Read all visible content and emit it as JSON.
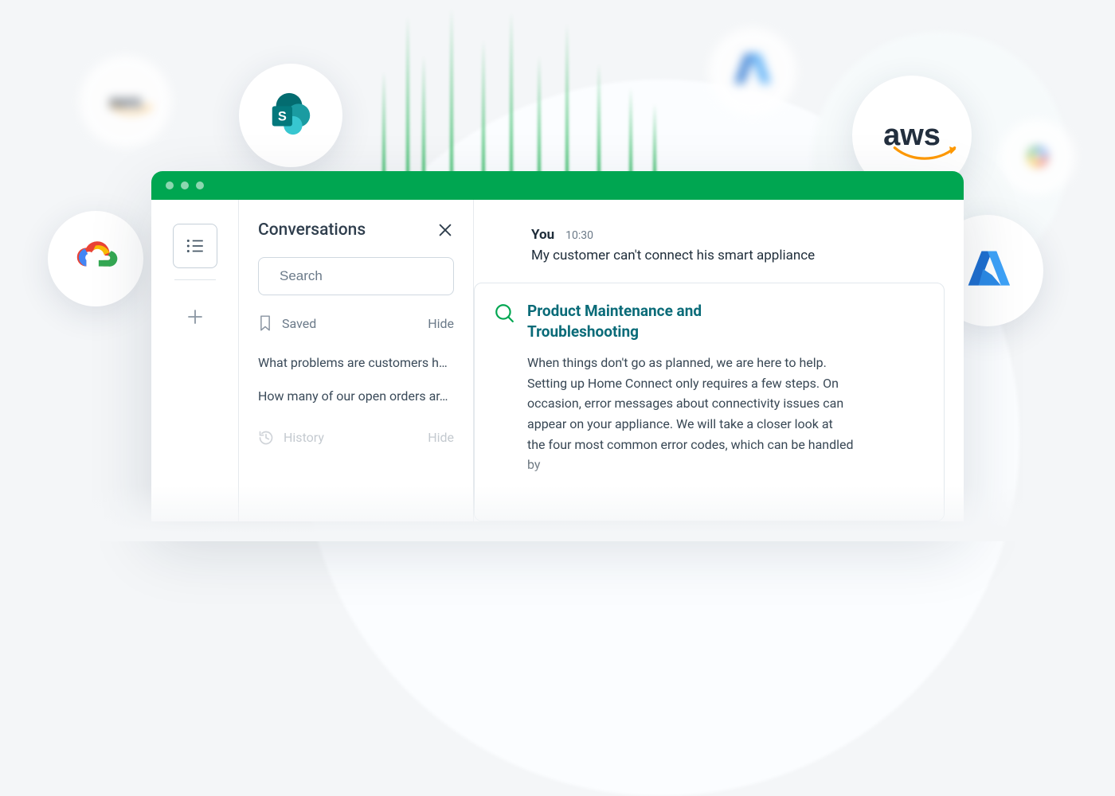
{
  "sidebar": {
    "title": "Conversations",
    "search_placeholder": "Search",
    "saved_label": "Saved",
    "hide_label": "Hide",
    "history_label": "History",
    "saved_items": [
      "What problems are customers h…",
      "How many of our open orders ar…"
    ]
  },
  "chat": {
    "sender": "You",
    "time": "10:30",
    "text": "My customer can't connect his smart appliance"
  },
  "answer": {
    "title": "Product Maintenance and Troubleshooting",
    "body": "When things don't go as planned, we are here to help. Setting up Home Connect only requires a few steps. On occasion, error messages about connectivity issues can appear on your appliance. We will take a closer look at the four most common error codes, which can be handled by"
  },
  "icons": {
    "list": "list-icon",
    "plus": "plus-icon",
    "close": "close-icon",
    "search": "search-icon",
    "bookmark": "bookmark-icon",
    "history": "history-icon",
    "answer": "magnifier-icon"
  },
  "bg_logos": [
    "aws",
    "sharepoint",
    "google-cloud",
    "azure"
  ]
}
